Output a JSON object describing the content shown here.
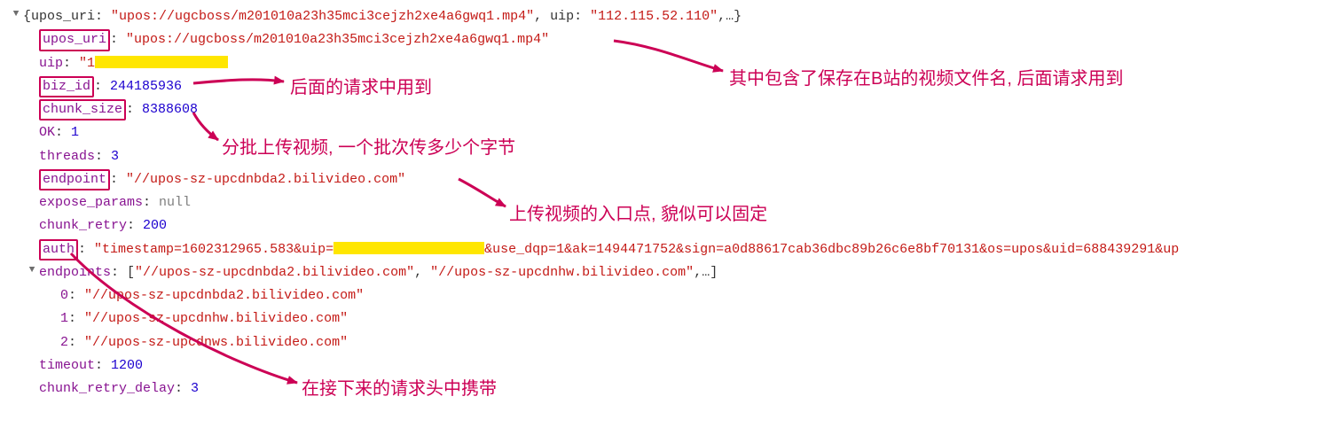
{
  "summary": {
    "prefix": "{upos_uri: ",
    "upos_uri_value": "\"upos://ugcboss/m201010a23h35mci3cejzh2xe4a6gwq1.mp4\"",
    "mid": ", uip: ",
    "uip_value": "\"112.115.52.110\"",
    "suffix": ",…}"
  },
  "entries": {
    "upos_uri": {
      "key": "upos_uri",
      "value": "\"upos://ugcboss/m201010a23h35mci3cejzh2xe4a6gwq1.mp4\""
    },
    "uip": {
      "key": "uip",
      "value_prefix": "\"1"
    },
    "biz_id": {
      "key": "biz_id",
      "value": "244185936"
    },
    "chunk_size": {
      "key": "chunk_size",
      "value": "8388608"
    },
    "OK": {
      "key": "OK",
      "value": "1"
    },
    "threads": {
      "key": "threads",
      "value": "3"
    },
    "endpoint": {
      "key": "endpoint",
      "value": "\"//upos-sz-upcdnbda2.bilivideo.com\""
    },
    "expose_params": {
      "key": "expose_params",
      "value": "null"
    },
    "chunk_retry": {
      "key": "chunk_retry",
      "value": "200"
    },
    "auth": {
      "key": "auth",
      "value_pre": "\"timestamp=1602312965.583&uip=",
      "value_post": "&use_dqp=1&ak=1494471752&sign=a0d88617cab36dbc89b26c6e8bf70131&os=upos&uid=688439291&up"
    },
    "endpoints": {
      "key": "endpoints",
      "prefix": "[",
      "item0": "\"//upos-sz-upcdnbda2.bilivideo.com\"",
      "item1": "\"//upos-sz-upcdnhw.bilivideo.com\"",
      "suffix": ",…]"
    },
    "endpoints_children": [
      {
        "idx": "0",
        "value": "\"//upos-sz-upcdnbda2.bilivideo.com\""
      },
      {
        "idx": "1",
        "value": "\"//upos-sz-upcdnhw.bilivideo.com\""
      },
      {
        "idx": "2",
        "value": "\"//upos-sz-upcdnws.bilivideo.com\""
      }
    ],
    "timeout": {
      "key": "timeout",
      "value": "1200"
    },
    "chunk_retry_delay": {
      "key": "chunk_retry_delay",
      "value": "3"
    }
  },
  "annotations": {
    "upos_uri": "其中包含了保存在B站的视频文件名, 后面请求用到",
    "biz_id": "后面的请求中用到",
    "chunk_size": "分批上传视频, 一个批次传多少个字节",
    "endpoint": "上传视频的入口点, 貌似可以固定",
    "auth": "在接下来的请求头中携带"
  },
  "redaction": {
    "uip_width": 150,
    "auth_width": 170,
    "color": "#ffe600"
  },
  "colors": {
    "annotation": "#cc0055",
    "boxBorder": "#cc0055"
  }
}
